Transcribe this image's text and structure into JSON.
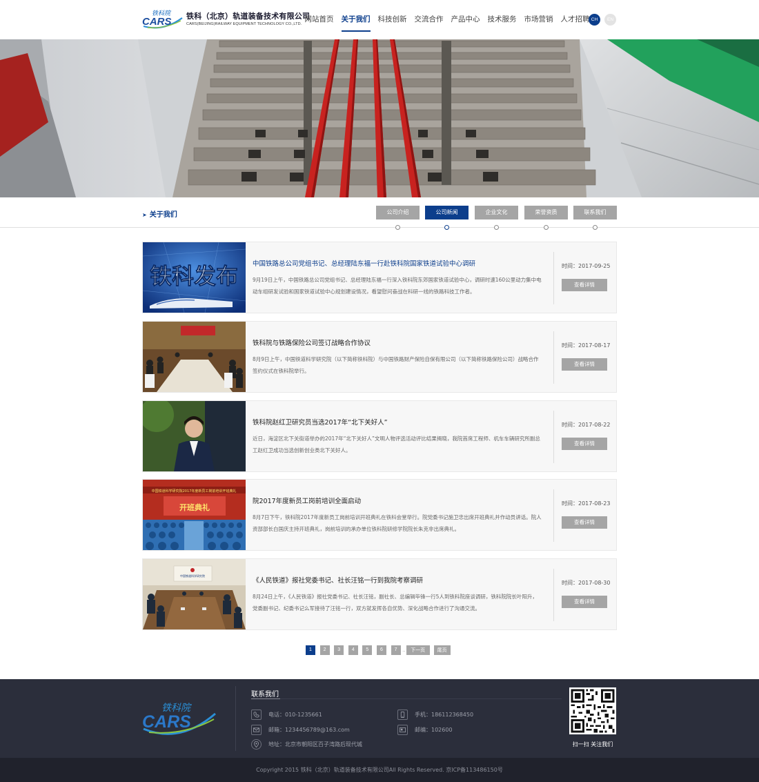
{
  "header": {
    "logo_mark_text": "铁科院",
    "logo_brand": "CARS",
    "company_cn": "铁科（北京）轨道装备技术有限公司",
    "company_en": "CARS(BEIJING)RAILWAY EQUIPMENT TECHNOLOGY CO.,LTD.",
    "nav": [
      {
        "label": "网站首页",
        "active": false
      },
      {
        "label": "关于我们",
        "active": true
      },
      {
        "label": "科技创新",
        "active": false
      },
      {
        "label": "交流合作",
        "active": false
      },
      {
        "label": "产品中心",
        "active": false
      },
      {
        "label": "技术服务",
        "active": false
      },
      {
        "label": "市场营销",
        "active": false
      },
      {
        "label": "人才招聘",
        "active": false
      }
    ],
    "lang_ch": "CH",
    "lang_en": "EN"
  },
  "subnav": {
    "section_title": "关于我们",
    "tabs": [
      {
        "label": "公司介绍",
        "active": false
      },
      {
        "label": "公司新闻",
        "active": true
      },
      {
        "label": "企业文化",
        "active": false
      },
      {
        "label": "荣誉资质",
        "active": false
      },
      {
        "label": "联系我们",
        "active": false
      }
    ]
  },
  "news": [
    {
      "thumb_text": "铁科发布",
      "title": "中国铁路总公司党组书记、总经理陆东福一行赴铁科院国家铁道试验中心调研",
      "desc": "9月19日上午，中国铁路总公司党组书记、总经理陆东福一行深入铁科院东郊国家铁道试验中心，调研时速160公里动力集中电动车组研发试验和国家铁道试验中心规划建设情况，看望慰问奋战在科研一线的铁路科技工作者。",
      "date": "时间：2017-09-25",
      "button": "查看详情",
      "highlight": true
    },
    {
      "title": "铁科院与铁路保险公司签订战略合作协议",
      "desc": "8月9日上午，中国铁道科学研究院（以下简称铁科院）与中国铁路财产保险自保有限公司（以下简称铁路保险公司）战略合作签约仪式在铁科院举行。",
      "date": "时间：2017-08-17",
      "button": "查看详情",
      "highlight": false
    },
    {
      "title": "铁科院赵红卫研究员当选2017年“北下关好人”",
      "desc": "近日，海淀区北下关街道举办的2017年“北下关好人”文明人物评选活动评比结果揭晓，我院首席工程师、机车车辆研究所副总工赵红卫成功当选创新创业类北下关好人。",
      "date": "时间：2017-08-22",
      "button": "查看详情",
      "highlight": false
    },
    {
      "thumb_banner": "中国铁道科学研究院2017年度新员工岗前培训开班典礼",
      "thumb_stage": "开班典礼",
      "title": "院2017年度新员工岗前培训全面启动",
      "desc": "8月7日下午，铁科院2017年度新员工岗前培训开班典礼在铁科会堂举行。院党委书记施卫忠出席开班典礼并作动员讲话。院人资部部长白国庆主持开班典礼，岗前培训的承办单位铁科院研修学院院长朱克非出席典礼。",
      "date": "时间：2017-08-23",
      "button": "查看详情",
      "highlight": false
    },
    {
      "thumb_sign": "中国铁道科学研究院",
      "title": "《人民铁道》报社党委书记、社长汪铭一行到我院考察调研",
      "desc": "8月24日上午，《人民铁道》报社党委书记、社长汪铭，副社长、总编辑毕锋一行5人到铁科院座谈调研，铁科院院长叶阳升，党委副书记、纪委书记么军接待了汪铭一行，双方就发挥各自优势、深化战略合作进行了沟通交流。",
      "date": "时间：2017-08-30",
      "button": "查看详情",
      "highlight": false
    }
  ],
  "pagination": {
    "pages": [
      "1",
      "2",
      "3",
      "4",
      "5",
      "6",
      "7"
    ],
    "current": "1",
    "dots": "..",
    "next": "下一页",
    "last": "尾页"
  },
  "footer": {
    "logo_mark_text": "铁科院",
    "logo_brand": "CARS",
    "heading": "联系我们",
    "phone": "电话：010-1235661",
    "mobile": "手机：18611236845​0",
    "email": "邮箱：1234456789@163.com",
    "postcode": "邮编：102600",
    "address": "地址：北京市朝阳区百子湾路后现代城",
    "qr_caption": "扫一扫  关注我们",
    "copyright": "Copyright 2015 铁科（北京）轨道装备技术有限公司All Rights Reserved. 京ICP备113486150号"
  },
  "colors": {
    "brand": "#0c3e8c",
    "tab_gray": "#a5a5a5",
    "footer_bg": "#2b2e3b",
    "copyright_bg": "#20222c"
  }
}
